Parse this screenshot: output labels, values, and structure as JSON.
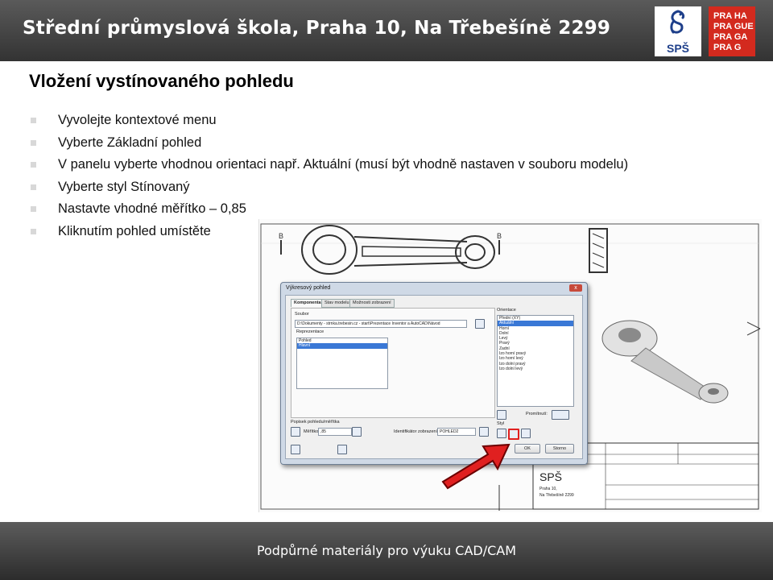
{
  "header": {
    "title": "Střední průmyslová škola, Praha 10, Na Třebešíně 2299",
    "sps_logo_text": "SPŠ",
    "prague_logo_lines": [
      "PRA HA",
      "PRA GUE",
      "PRA GA",
      "PRA G"
    ]
  },
  "slide": {
    "title": "Vložení vystínovaného pohledu",
    "bullets": [
      "Vyvolejte kontextové menu",
      "Vyberte Základní pohled",
      "V panelu vyberte vhodnou orientaci např. Aktuální (musí být vhodně nastaven v souboru modelu)",
      "Vyberte styl Stínovaný",
      "Nastavte vhodné měřítko – 0,85",
      "Kliknutím pohled umístěte"
    ]
  },
  "drawing": {
    "section_marks": [
      "B",
      "B"
    ],
    "title_block_school": "SPŠ",
    "title_block_address": [
      "Praha 10,",
      "Na Třebešíně 2299"
    ]
  },
  "dialog": {
    "title": "Výkresový pohled",
    "close_label": "x",
    "tabs": [
      "Komponenta",
      "Stav modelu",
      "Možnosti zobrazení"
    ],
    "file_label": "Soubor",
    "file_value": "D:\\Dokumenty - strnka.trebesin.cz - start\\Prezentace Inventor a AutoCAD\\Návod",
    "representations_label": "Reprezentace",
    "repr_items": [
      "Pohled",
      "Hlavní"
    ],
    "orientation_label": "Orientace",
    "orientation_items": [
      "Přední (XY)",
      "Aktuální",
      "Horní",
      "Dolní",
      "Levý",
      "Pravý",
      "Zadní",
      "Izo horní pravý",
      "Izo horní levý",
      "Izo dolní pravý",
      "Izo dolní levý"
    ],
    "orientation_selected": 1,
    "projection_label": "Promítnutí:",
    "view_label_section": "Popisek pohledu/měřítka",
    "scale_label": "Měřítko",
    "scale_value": ",85",
    "view_id_label": "Identifikátor zobrazení",
    "view_id_value": "POHLED2",
    "style_label": "Styl",
    "ok_label": "OK",
    "cancel_label": "Storno"
  },
  "footer": {
    "text": "Podpůrné materiály pro výuku CAD/CAM"
  },
  "colors": {
    "header_bg": "#444444",
    "prague_red": "#d32a1e",
    "sps_blue": "#1e3f8a",
    "arrow_red": "#e02020",
    "selection_blue": "#3a78d6"
  }
}
